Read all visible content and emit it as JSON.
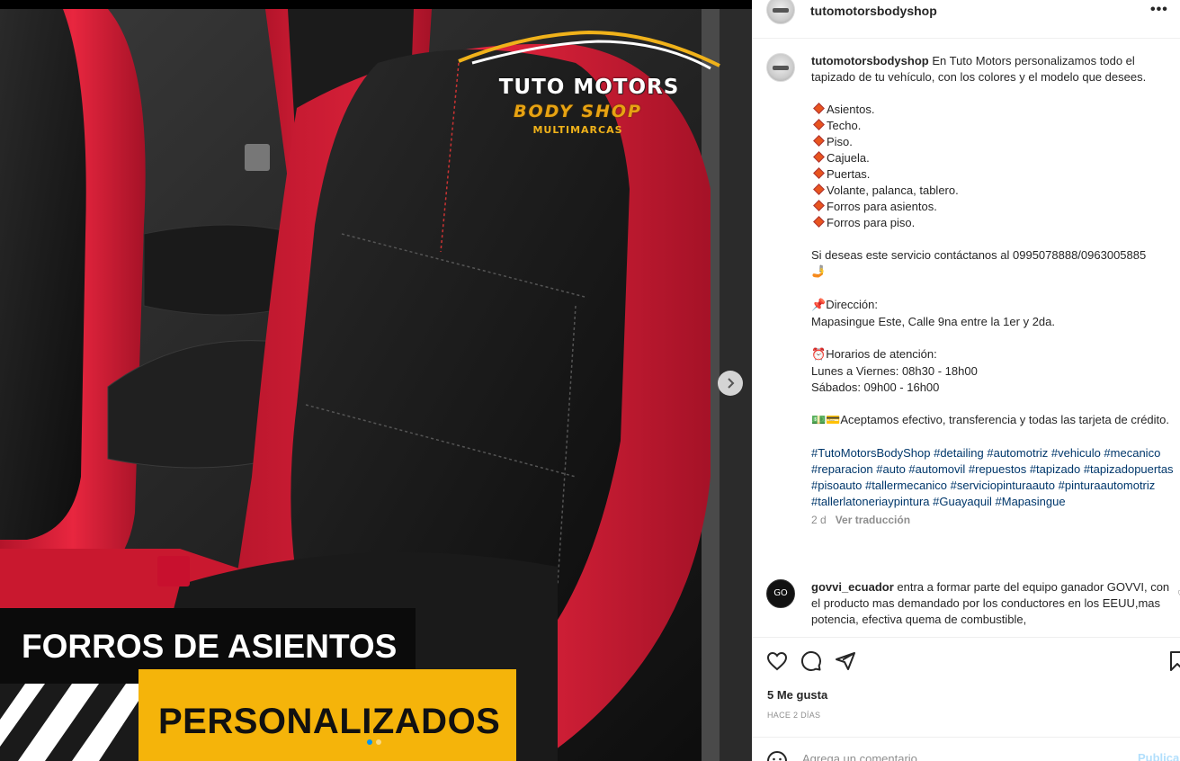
{
  "post": {
    "username": "tutomotorsbodyshop",
    "more_icon": "more-horizontal-icon",
    "image": {
      "logo_line1": "TUTO MOTORS",
      "logo_line2": "BODY SHOP",
      "logo_line3": "MULTIMARCAS",
      "banner_top": "FORROS DE ASIENTOS",
      "banner_bottom": "PERSONALIZADOS",
      "slide_count": 2,
      "active_slide": 1
    },
    "caption": {
      "username": "tutomotorsbodyshop",
      "intro": " En Tuto Motors personalizamos todo el tapizado de tu vehículo, con los colores y el modelo que desees.",
      "items": [
        "Asientos.",
        "Techo.",
        "Piso.",
        "Cajuela.",
        "Puertas.",
        "Volante, palanca, tablero.",
        "Forros para asientos.",
        "Forros para piso."
      ],
      "contact": "Si deseas este servicio contáctanos al 0995078888/0963005885",
      "address_label": "Dirección:",
      "address": "Mapasingue Este, Calle 9na entre la 1er y 2da.",
      "hours_label": "Horarios de atención:",
      "hours_weekdays": "Lunes a Viernes: 08h30 - 18h00",
      "hours_saturday": "Sábados: 09h00 - 16h00",
      "payment": "Aceptamos efectivo, transferencia y todas las tarjeta de crédito.",
      "hashtags": "#TutoMotorsBodyShop #detailing #automotriz #vehiculo #mecanico #reparacion #auto #automovil #repuestos #tapizado #tapizadopuertas #pisoauto #tallermecanico #serviciopinturaauto #pinturaautomotriz #tallerlatoneriaypintura #Guayaquil #Mapasingue",
      "age": "2 d",
      "translate": "Ver traducción"
    },
    "comment": {
      "avatar_text": "GO",
      "username": "govvi_ecuador",
      "text": " entra a formar parte del equipo ganador GOVVI, con el producto mas demandado por los conductores en los EEUU,mas potencia, efectiva quema de combustible,"
    },
    "likes": "5 Me gusta",
    "time_ago": "HACE 2 DÍAS",
    "add_comment_placeholder": "Agrega un comentario...",
    "publish_label": "Publicar"
  },
  "colors": {
    "seat_red": "#e0223b",
    "seat_black": "#161616",
    "banner_yellow": "#f5b40a",
    "link_blue": "#00376b",
    "publish_blue": "#b2dffc"
  }
}
